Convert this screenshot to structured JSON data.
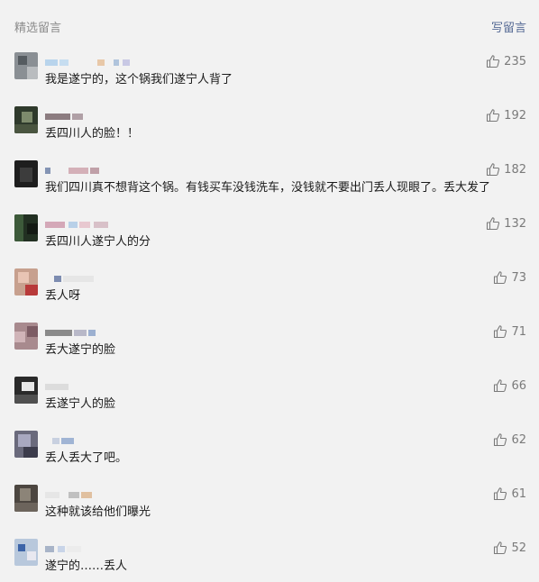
{
  "header": {
    "title": "精选留言",
    "write_label": "写留言"
  },
  "comments": [
    {
      "text": "我是遂宁的，这个锅我们遂宁人背了",
      "likes": "235"
    },
    {
      "text": "丢四川人的脸！！",
      "likes": "192"
    },
    {
      "text": "我们四川真不想背这个锅。有钱买车没钱洗车，没钱就不要出门丢人现眼了。丢大发了",
      "likes": "182"
    },
    {
      "text": "丢四川人遂宁人的分",
      "likes": "132"
    },
    {
      "text": "丢人呀",
      "likes": "73"
    },
    {
      "text": "丢大遂宁的脸",
      "likes": "71"
    },
    {
      "text": "丢遂宁人的脸",
      "likes": "66"
    },
    {
      "text": "丢人丢大了吧。",
      "likes": "62"
    },
    {
      "text": "这种就该给他们曝光",
      "likes": "61"
    },
    {
      "text": "遂宁的……丢人",
      "likes": "52"
    }
  ],
  "icons": {
    "like": "thumbs-up-icon"
  },
  "colors": {
    "link": "#576b95",
    "background": "#f2f2f2",
    "muted": "#8c8c8c"
  }
}
